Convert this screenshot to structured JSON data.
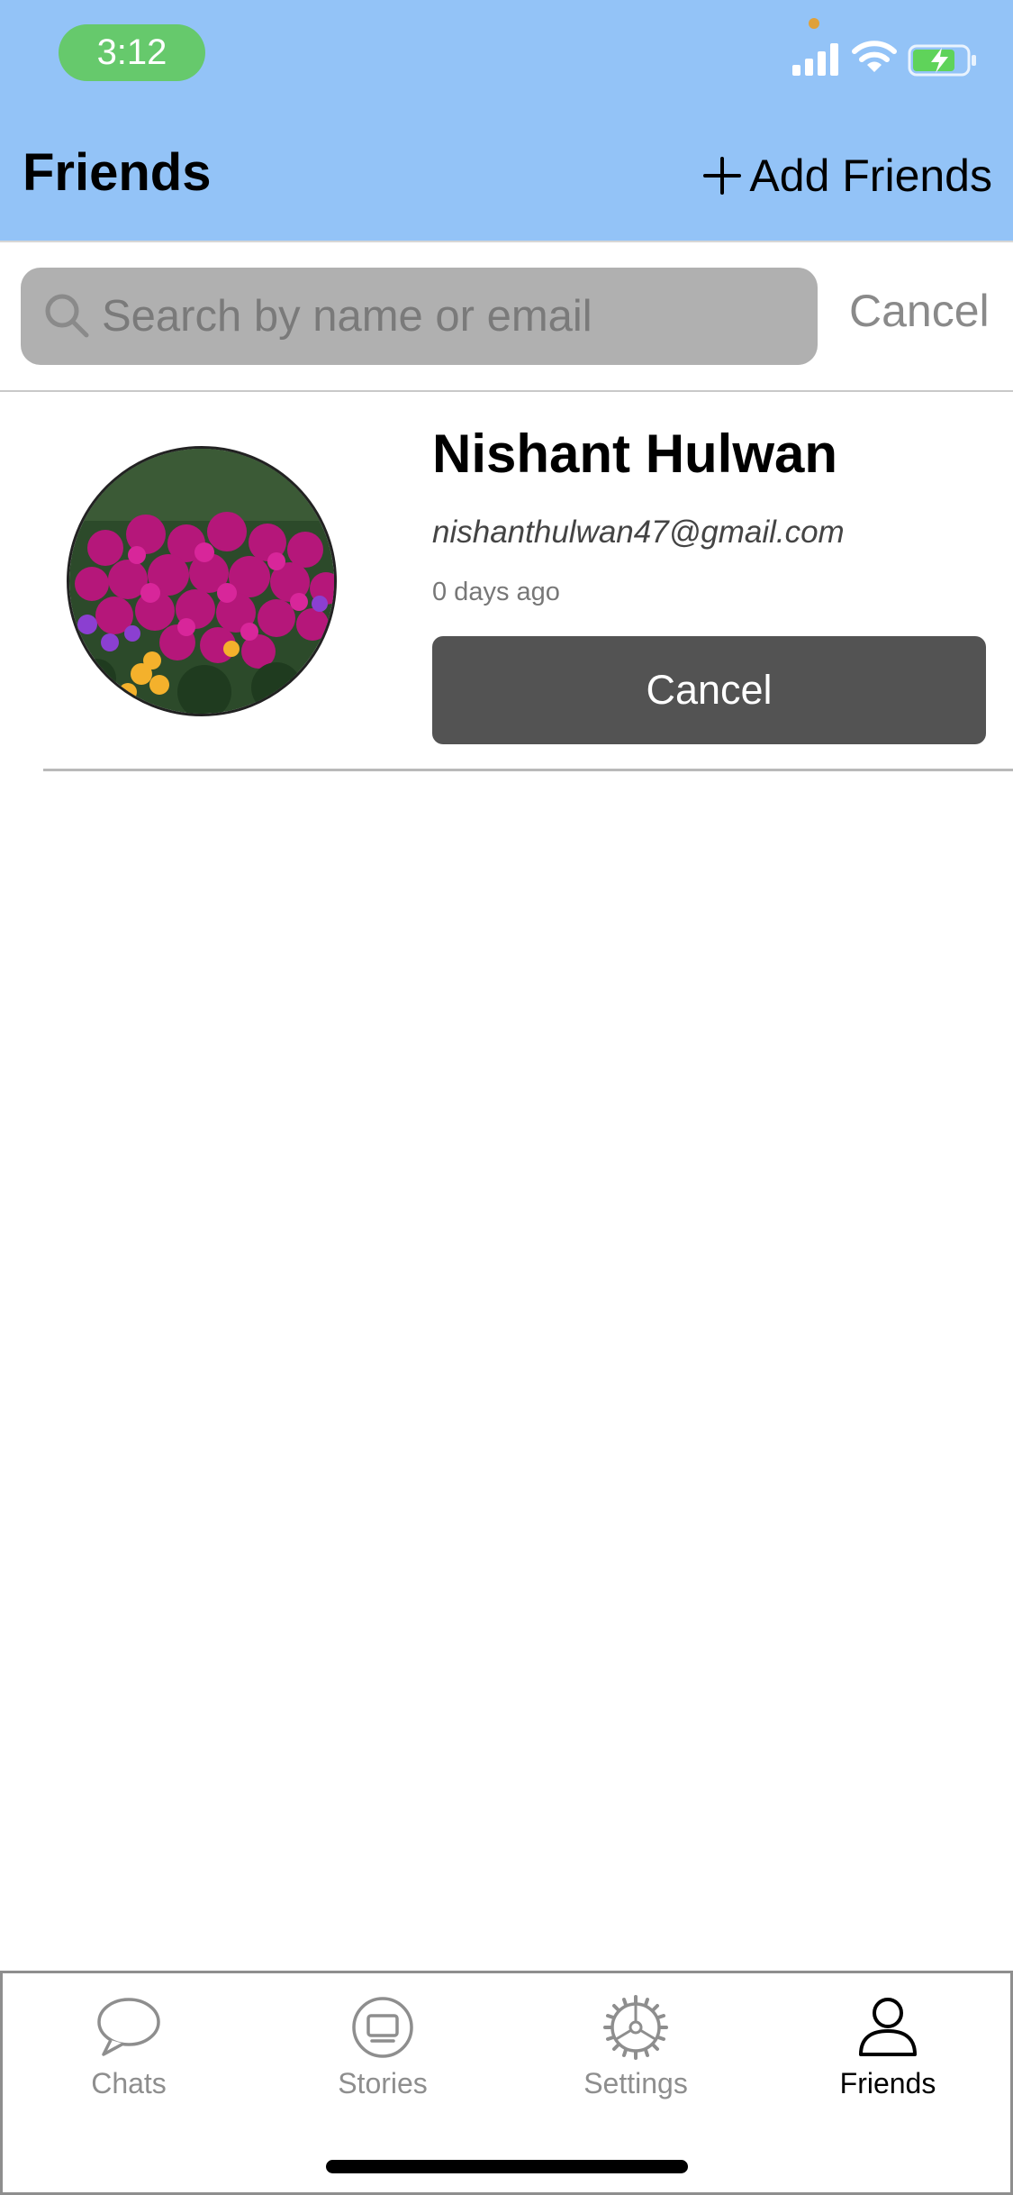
{
  "status_bar": {
    "time": "3:12"
  },
  "header": {
    "title": "Friends",
    "add_button_label": "Add Friends"
  },
  "search": {
    "placeholder": "Search by name or email",
    "value": "",
    "cancel_label": "Cancel"
  },
  "friends": [
    {
      "name": "Nishant Hulwan",
      "email": "nishanthulwan47@gmail.com",
      "time": "0 days ago",
      "action_label": "Cancel"
    }
  ],
  "tabbar": {
    "tabs": [
      {
        "label": "Chats",
        "icon": "chat-bubble-icon",
        "active": false
      },
      {
        "label": "Stories",
        "icon": "tv-icon",
        "active": false
      },
      {
        "label": "Settings",
        "icon": "gear-icon",
        "active": false
      },
      {
        "label": "Friends",
        "icon": "person-icon",
        "active": true
      }
    ]
  },
  "colors": {
    "header_bg": "#93c3f7",
    "time_pill": "#66c96c",
    "search_bg": "#b0b0b0",
    "button_bg": "#535353",
    "tab_inactive": "#8e8e8e",
    "tab_active": "#000000"
  }
}
